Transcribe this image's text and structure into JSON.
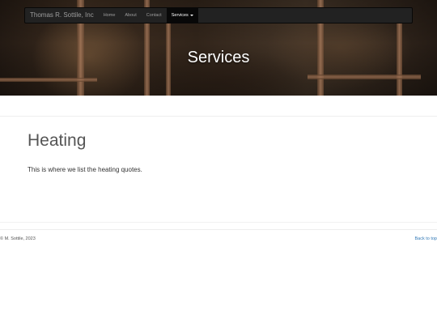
{
  "navbar": {
    "brand": "Thomas R. Sottile, Inc",
    "items": [
      {
        "label": "Home"
      },
      {
        "label": "About"
      },
      {
        "label": "Contact"
      },
      {
        "label": "Services"
      }
    ],
    "active_item": "Services"
  },
  "hero": {
    "title": "Services"
  },
  "main": {
    "heading": "Heating",
    "text": "This is where we list the heating quotes."
  },
  "footer": {
    "copyright": "© M. Sottile, 2023",
    "back_to_top": "Back to top"
  },
  "colors": {
    "navbar_bg": "#222222",
    "link": "#337ab7"
  },
  "icons": {
    "services_dropdown": "caret-down-icon"
  }
}
